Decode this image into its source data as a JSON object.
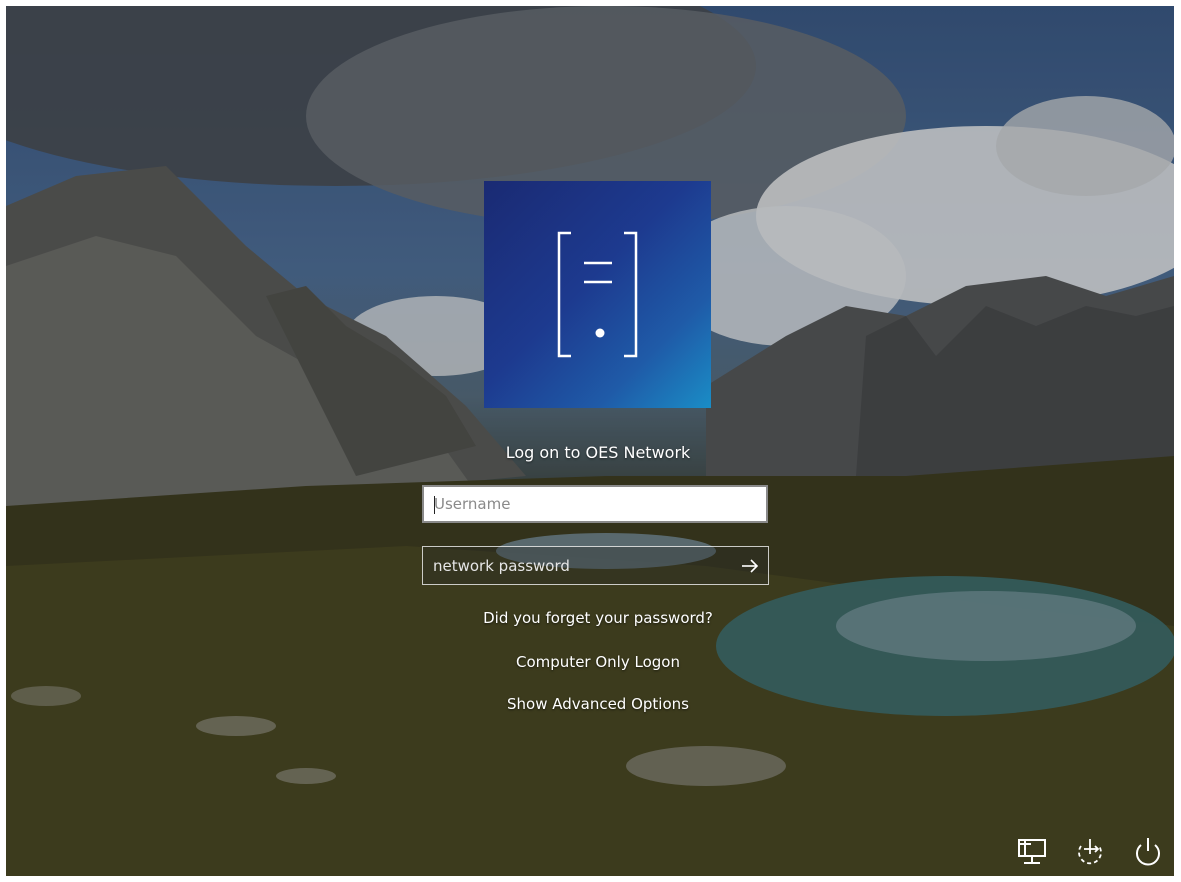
{
  "screen": {
    "title": "Log on to OES Network"
  },
  "logo": {
    "icon": "server-tower-icon"
  },
  "form": {
    "username_placeholder": "Username",
    "username_value": "",
    "password_placeholder": "network password",
    "password_value": "",
    "submit_icon": "arrow-right-icon"
  },
  "links": {
    "forgot_password": "Did you forget your password?",
    "computer_only": "Computer Only Logon",
    "advanced_options": "Show Advanced Options"
  },
  "corner_buttons": [
    {
      "icon": "network-icon"
    },
    {
      "icon": "ease-of-access-icon"
    },
    {
      "icon": "power-icon"
    }
  ],
  "colors": {
    "tile_start": "#1a2a73",
    "tile_end": "#1a8dc6",
    "text": "#ffffff"
  }
}
